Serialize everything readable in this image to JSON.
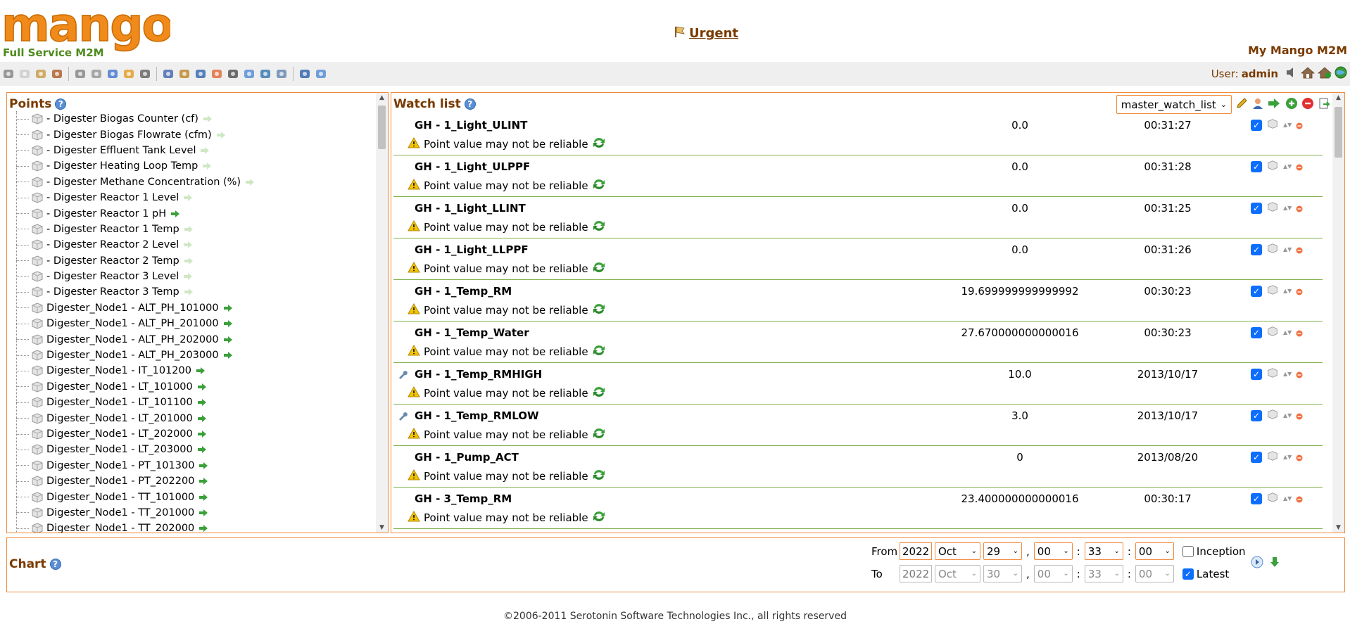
{
  "header": {
    "logo_text": "mango",
    "logo_subtext": "Full Service M2M",
    "urgent_label": "Urgent",
    "app_name": "My Mango M2M"
  },
  "user": {
    "label": "User:",
    "name": "admin"
  },
  "toolbar": {
    "icons": [
      "watch-list-icon",
      "graphic-views-icon",
      "events-icon",
      "reports-icon",
      "data-sources-icon",
      "scheduled-events-icon",
      "compound-events-icon",
      "event-handlers-icon",
      "point-links-icon",
      "users-icon",
      "point-hierarchy-icon",
      "mailing-lists-icon",
      "publishers-icon",
      "maintenance-events-icon",
      "system-settings-icon",
      "emport-icon",
      "sql-console-icon",
      "logout-icon",
      "help-icon"
    ]
  },
  "points": {
    "title": "Points",
    "items": [
      "- Digester Biogas Counter (cf)",
      "- Digester Biogas Flowrate (cfm)",
      "- Digester Effluent Tank Level",
      "- Digester Heating Loop Temp",
      "- Digester Methane Concentration (%)",
      "- Digester Reactor 1 Level",
      "- Digester Reactor 1 pH",
      "- Digester Reactor 1 Temp",
      "- Digester Reactor 2 Level",
      "- Digester Reactor 2 Temp",
      "- Digester Reactor 3 Level",
      "- Digester Reactor 3 Temp",
      "Digester_Node1 - ALT_PH_101000",
      "Digester_Node1 - ALT_PH_201000",
      "Digester_Node1 - ALT_PH_202000",
      "Digester_Node1 - ALT_PH_203000",
      "Digester_Node1 - IT_101200",
      "Digester_Node1 - LT_101000",
      "Digester_Node1 - LT_101100",
      "Digester_Node1 - LT_201000",
      "Digester_Node1 - LT_202000",
      "Digester_Node1 - LT_203000",
      "Digester_Node1 - PT_101300",
      "Digester_Node1 - PT_202200",
      "Digester_Node1 - TT_101000",
      "Digester_Node1 - TT_201000",
      "Digester_Node1 - TT_202000"
    ],
    "arrow_active": [
      false,
      false,
      false,
      false,
      false,
      false,
      true,
      false,
      false,
      false,
      false,
      false,
      true,
      true,
      true,
      true,
      true,
      true,
      true,
      true,
      true,
      true,
      true,
      true,
      true,
      true,
      true
    ]
  },
  "watch": {
    "title": "Watch list",
    "selected_list": "master_watch_list",
    "warning_text": "Point value may not be reliable",
    "rows": [
      {
        "name": "GH - 1_Light_ULINT",
        "value": "0.0",
        "time": "00:31:27",
        "settable": false
      },
      {
        "name": "GH - 1_Light_ULPPF",
        "value": "0.0",
        "time": "00:31:28",
        "settable": false
      },
      {
        "name": "GH - 1_Light_LLINT",
        "value": "0.0",
        "time": "00:31:25",
        "settable": false
      },
      {
        "name": "GH - 1_Light_LLPPF",
        "value": "0.0",
        "time": "00:31:26",
        "settable": false
      },
      {
        "name": "GH - 1_Temp_RM",
        "value": "19.699999999999992",
        "time": "00:30:23",
        "settable": false
      },
      {
        "name": "GH - 1_Temp_Water",
        "value": "27.670000000000016",
        "time": "00:30:23",
        "settable": false
      },
      {
        "name": "GH - 1_Temp_RMHIGH",
        "value": "10.0",
        "time": "2013/10/17",
        "settable": true
      },
      {
        "name": "GH - 1_Temp_RMLOW",
        "value": "3.0",
        "time": "2013/10/17",
        "settable": true
      },
      {
        "name": "GH - 1_Pump_ACT",
        "value": "0",
        "time": "2013/08/20",
        "settable": false
      },
      {
        "name": "GH - 3_Temp_RM",
        "value": "23.400000000000016",
        "time": "00:30:17",
        "settable": false
      }
    ]
  },
  "chart": {
    "title": "Chart",
    "from": {
      "label": "From",
      "year": "2022",
      "month": "Oct",
      "day": "29",
      "hour": "00",
      "minute": "33",
      "second": "00",
      "option_label": "Inception",
      "option_checked": false
    },
    "to": {
      "label": "To",
      "year": "2022",
      "month": "Oct",
      "day": "30",
      "hour": "00",
      "minute": "33",
      "second": "00",
      "option_label": "Latest",
      "option_checked": true
    },
    "date_sep": ",",
    "time_sep": ":"
  },
  "footer": {
    "text": "©2006-2011 Serotonin Software Technologies Inc., all rights reserved"
  },
  "colors": {
    "brand_orange": "#f08a3c",
    "title_brown": "#7a3a00",
    "row_divider": "#7fb04a"
  }
}
